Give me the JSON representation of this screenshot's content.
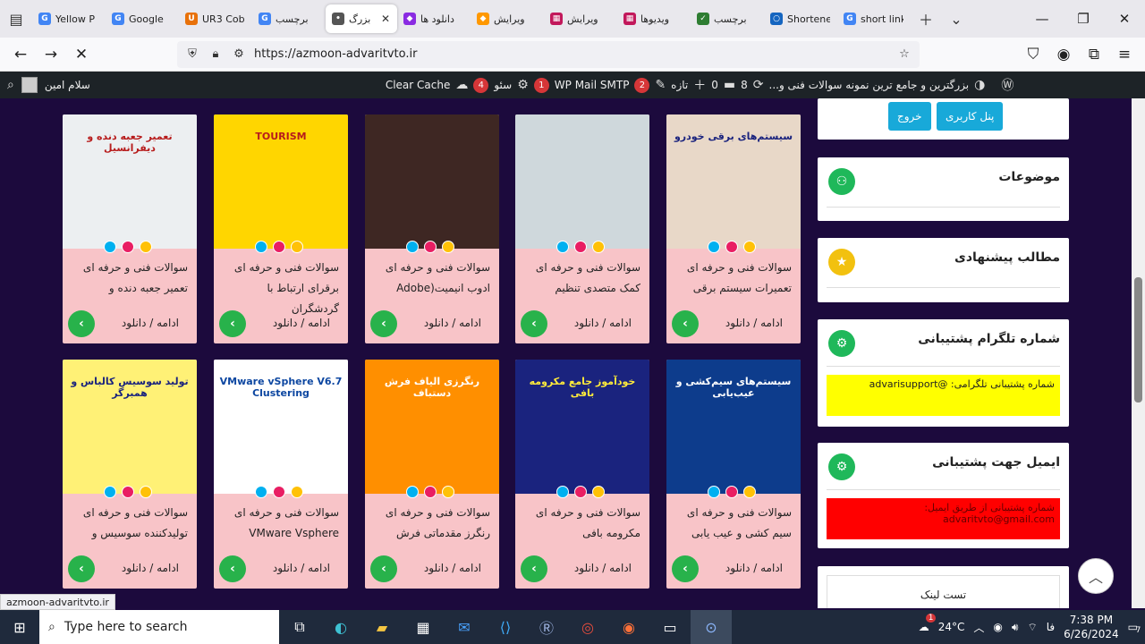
{
  "browser": {
    "tabs": [
      {
        "title": "Yellow P",
        "fav": "G",
        "color": "#4285f4"
      },
      {
        "title": "Google",
        "fav": "G",
        "color": "#4285f4"
      },
      {
        "title": "UR3 Cob",
        "fav": "U",
        "color": "#e8710a"
      },
      {
        "title": "برچسب",
        "fav": "G",
        "color": "#4285f4"
      },
      {
        "title": "بزرگ",
        "fav": "•",
        "color": "#555"
      },
      {
        "title": "دانلود ها",
        "fav": "◆",
        "color": "#8a2be2"
      },
      {
        "title": "ویرایش",
        "fav": "◆",
        "color": "#ff9800"
      },
      {
        "title": "ویرایش",
        "fav": "▦",
        "color": "#c2185b"
      },
      {
        "title": "ویدیوها",
        "fav": "▦",
        "color": "#c2185b"
      },
      {
        "title": "برچسب",
        "fav": "✓",
        "color": "#2e7d32"
      },
      {
        "title": "Shortene",
        "fav": "○",
        "color": "#1565c0"
      },
      {
        "title": "short link",
        "fav": "G",
        "color": "#4285f4"
      }
    ],
    "active_tab_index": 4,
    "url": "https://azmoon-advaritvto.ir",
    "status_url": "azmoon-advaritvto.ir"
  },
  "wpbar": {
    "user_greeting": "سلام امین",
    "clear_cache": "Clear Cache",
    "seo_label": "سئو",
    "seo_count": "4",
    "smtp_label": "WP Mail SMTP",
    "smtp_count": "1",
    "wp_count": "2",
    "new_label": "تازه",
    "comments_count": "0",
    "updates_count": "8",
    "site_title": "بزرگترین و جامع ترین نمونه سوالات فنی و..."
  },
  "cards": [
    {
      "title": "سوالات فنی و حرفه ای تعمیرات سیستم برقی",
      "cap": "سیستم‌های برقی خودرو",
      "bg": "#e8d8c8",
      "capcolor": "#1a237e"
    },
    {
      "title": "سوالات فنی و حرفه ای کمک متصدی تنظیم",
      "cap": "",
      "bg": "#cfd8dc",
      "capcolor": "#222"
    },
    {
      "title": "سوالات فنی و حرفه ای ادوب انیمیت(Adobe",
      "cap": "",
      "bg": "#3e2723",
      "capcolor": "#fff"
    },
    {
      "title": "سوالات فنی و حرفه ای برقرای ارتباط با گردشگران",
      "cap": "TOURISM",
      "bg": "#ffd600",
      "capcolor": "#b71c1c"
    },
    {
      "title": "سوالات فنی و حرفه ای تعمیر جعبه دنده و",
      "cap": "تعمیر جعبه دنده و دیفرانسیل",
      "bg": "#eceff1",
      "capcolor": "#b71c1c"
    },
    {
      "title": "سوالات فنی و حرفه ای سیم کشی و عیب یابی",
      "cap": "سیستم‌های سیم‌کشی و عیب‌یابی",
      "bg": "#0d3c8c",
      "capcolor": "#fff"
    },
    {
      "title": "سوالات فنی و حرفه ای مکرومه بافی",
      "cap": "خودآموز جامع مکرومه بافی",
      "bg": "#1a237e",
      "capcolor": "#ffeb3b"
    },
    {
      "title": "سوالات فنی و حرفه ای رنگرز مقدماتی فرش",
      "cap": "رنگرزی الیاف فرش دستباف",
      "bg": "#ff8f00",
      "capcolor": "#fff"
    },
    {
      "title": "سوالات فنی و حرفه ای VMware Vsphere",
      "cap": "VMware vSphere V6.7 Clustering",
      "bg": "#ffffff",
      "capcolor": "#0d47a1"
    },
    {
      "title": "سوالات فنی و حرفه ای تولیدکننده سوسیس و",
      "cap": "تولید سوسیس کالباس و همبرگر",
      "bg": "#fff176",
      "capcolor": "#1a237e"
    }
  ],
  "card_more_label": "ادامه / دانلود",
  "dot_colors": [
    "#00b0f0",
    "#e91e63",
    "#ffc107"
  ],
  "sidebar": {
    "panel_button": "پنل کاربری",
    "logout_button": "خروج",
    "topics_title": "موضوعات",
    "suggested_title": "مطالب پیشنهادی",
    "telegram_title": "شماره تلگرام پشتیبانی",
    "telegram_text": "شماره پشتیبانی تلگرامی: @advarisupport",
    "email_title": "ایمیل جهت پشتیبانی",
    "email_text": "شماره پشتیبانی از طریق ایمیل: advaritvto@gmail.com",
    "test_link": "تست لینک"
  },
  "taskbar": {
    "search_placeholder": "Type here to search",
    "temperature": "24°C",
    "lang": "فا",
    "time": "7:38 PM",
    "date": "6/26/2024",
    "notif_count": "7",
    "weather_badge": "1"
  }
}
